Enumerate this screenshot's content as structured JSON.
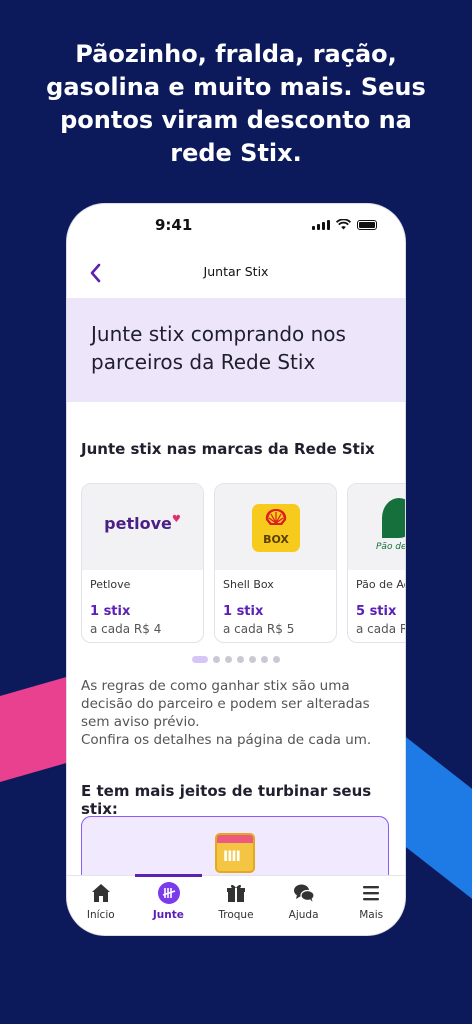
{
  "headline": {
    "line1": "Pãozinho, fralda, ração,",
    "line2": "gasolina e muito mais. Seus",
    "line3": "pontos viram desconto na",
    "line4": "rede Stix."
  },
  "status_bar": {
    "time": "9:41"
  },
  "nav": {
    "title": "Juntar Stix"
  },
  "hero": {
    "title": "Junte stix comprando nos parceiros da Rede Stix"
  },
  "brands_section": {
    "title": "Junte stix nas marcas da Rede Stix"
  },
  "partners": [
    {
      "name": "Petlove",
      "stix": "1 stix",
      "rate": "a cada R$ 4",
      "logo_text": "petlove"
    },
    {
      "name": "Shell Box",
      "stix": "1 stix",
      "rate": "a cada R$ 5",
      "logo_text": "BOX"
    },
    {
      "name": "Pão de Açúcar",
      "stix": "5 stix",
      "rate": "a cada R$",
      "logo_text": "Pão de Açúcar"
    }
  ],
  "carousel": {
    "active_index": 0,
    "count": 7
  },
  "rules": {
    "line1": "As regras de como ganhar stix são uma",
    "line2": "decisão do parceiro e podem ser alteradas",
    "line3": "sem aviso prévio.",
    "line4": "Confira os detalhes na página de cada um."
  },
  "more_section": {
    "title": "E tem mais jeitos de turbinar seus stix:"
  },
  "tabbar": {
    "active": "Junte",
    "tabs": [
      {
        "label": "Início",
        "icon": "home-icon"
      },
      {
        "label": "Junte",
        "icon": "stix-collect-icon"
      },
      {
        "label": "Troque",
        "icon": "gift-icon"
      },
      {
        "label": "Ajuda",
        "icon": "chat-icon"
      },
      {
        "label": "Mais",
        "icon": "menu-icon"
      }
    ]
  },
  "colors": {
    "background": "#0c1a5c",
    "accent": "#5b21b6",
    "hero_bg": "#ede6fb",
    "deco_pink": "#e9408f",
    "deco_blue": "#1e7be6",
    "deco_green": "#19a84a"
  }
}
